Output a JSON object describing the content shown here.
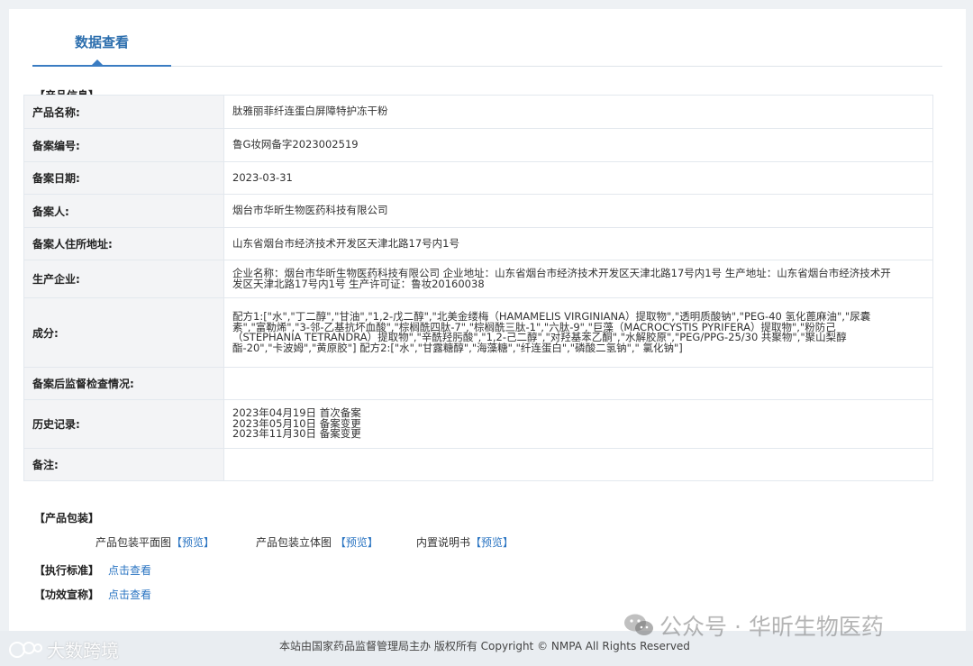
{
  "tab": {
    "label": "数据查看"
  },
  "product_info": {
    "section_title": "【产品信息】",
    "rows": [
      {
        "key": "产品名称:",
        "value": "肽雅丽菲纤连蛋白屏障特护冻干粉"
      },
      {
        "key": "备案编号:",
        "value": "鲁G妆网备字2023002519"
      },
      {
        "key": "备案日期:",
        "value": "2023-03-31"
      },
      {
        "key": "备案人:",
        "value": "烟台市华昕生物医药科技有限公司"
      },
      {
        "key": "备案人住所地址:",
        "value": "山东省烟台市经济技术开发区天津北路17号内1号"
      },
      {
        "key": "生产企业:",
        "value": "企业名称：烟台市华昕生物医药科技有限公司 企业地址：山东省烟台市经济技术开发区天津北路17号内1号 生产地址：山东省烟台市经济技术开发区天津北路17号内1号 生产许可证：鲁妆20160038"
      },
      {
        "key": "成分:",
        "value": "配方1:[\"水\",\"丁二醇\",\"甘油\",\"1,2-戊二醇\",\"北美金缕梅（HAMAMELIS VIRGINIANA）提取物\",\"透明质酸钠\",\"PEG-40 氢化蓖麻油\",\"尿囊素\",\"富勒烯\",\"3-邻-乙基抗坏血酸\",\"棕榈酰四肽-7\",\"棕榈酰三肽-1\",\"六肽-9\",\"巨藻（MACROCYSTIS PYRIFERA）提取物\",\"粉防己（STEPHANIA TETRANDRA）提取物\",\"辛酰羟肟酸\",\"1,2-己二醇\",\"对羟基苯乙酮\",\"水解胶原\",\"PEG/PPG-25/30 共聚物\",\"聚山梨醇酯-20\",\"卡波姆\",\"黄原胶\"] 配方2:[\"水\",\"甘露糖醇\",\"海藻糖\",\"纤连蛋白\",\"磷酸二氢钠\",\" 氯化钠\"]"
      },
      {
        "key": "备案后监督检查情况:",
        "value": ""
      },
      {
        "key": "历史记录:",
        "lines": [
          "2023年04月19日 首次备案",
          "2023年05月10日 备案变更",
          "2023年11月30日 备案变更"
        ]
      },
      {
        "key": "备注:",
        "value": ""
      }
    ]
  },
  "packaging": {
    "section_title": "【产品包装】",
    "items": [
      {
        "label": "产品包装平面图",
        "link": "【预览】"
      },
      {
        "label": "产品包装立体图 ",
        "link": "【预览】"
      },
      {
        "label": "内置说明书",
        "link": "【预览】"
      }
    ]
  },
  "standard": {
    "label": "【执行标准】",
    "link": "点击查看"
  },
  "efficacy": {
    "label": "【功效宣称】",
    "link": "点击查看"
  },
  "footer": {
    "text": "本站由国家药品监督管理局主办 版权所有 Copyright © NMPA All Rights Reserved"
  },
  "watermarks": {
    "left": "大数跨境",
    "right": "公众号 · 华昕生物医药",
    "right_icon": "wechat-icon"
  }
}
